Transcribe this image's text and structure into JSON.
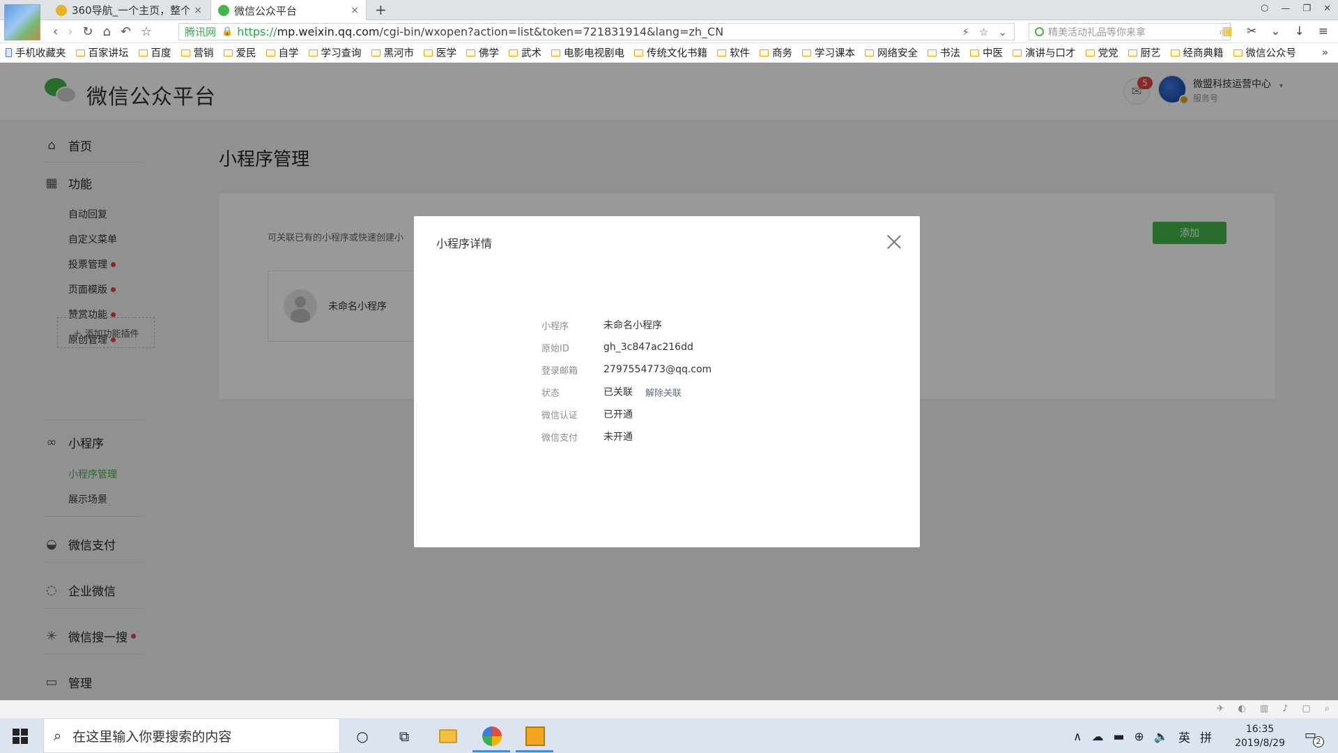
{
  "browser": {
    "tabs": [
      {
        "title": "360导航_一个主页，整个",
        "close": "×"
      },
      {
        "title": "微信公众平台",
        "close": "×"
      }
    ],
    "new_tab": "+",
    "window_controls": [
      "⬡",
      "—",
      "❐",
      "✕"
    ],
    "nav": {
      "back": "‹",
      "forward": "›",
      "reload": "↻",
      "home": "⌂",
      "undo": "↶",
      "favorite": "☆"
    },
    "address": {
      "shield_label": "腾讯网",
      "scheme": "https://",
      "host": "mp.weixin.qq.com",
      "path": "/cgi-bin/wxopen?action=list&token=721831914&lang=zh_CN",
      "icons": [
        "⚡",
        "☆",
        "⌄"
      ]
    },
    "search": {
      "placeholder": "精美活动礼品等你来拿",
      "icon": "⌕"
    },
    "tool_icons": [
      "▦",
      "✂",
      "⌄",
      "↓",
      "≡"
    ],
    "bookmarks": [
      "手机收藏夹",
      "百家讲坛",
      "百度",
      "营销",
      "爱民",
      "自学",
      "学习查询",
      "黑河市",
      "医学",
      "佛学",
      "武术",
      "电影电视剧电",
      "传统文化书籍",
      "软件",
      "商务",
      "学习课本",
      "网络安全",
      "书法",
      "中医",
      "演讲与口才",
      "党党",
      "厨艺",
      "经商典籍",
      "微信公众号"
    ],
    "bookmarks_more": "»"
  },
  "header": {
    "site_title": "微信公众平台",
    "message_icon": "✉",
    "message_count": "5",
    "account_name": "微盟科技运营中心",
    "account_type": "服务号",
    "caret": "▾"
  },
  "sidebar": {
    "home": {
      "icon": "⌂",
      "label": "首页"
    },
    "features": {
      "icon": "▦",
      "label": "功能",
      "items": [
        {
          "label": "自动回复",
          "dot": false
        },
        {
          "label": "自定义菜单",
          "dot": false
        },
        {
          "label": "投票管理",
          "dot": true
        },
        {
          "label": "页面模版",
          "dot": true
        },
        {
          "label": "赞赏功能",
          "dot": true
        },
        {
          "label": "原创管理",
          "dot": true
        }
      ],
      "add_plugin": "＋ 添加功能插件"
    },
    "miniprogram": {
      "icon": "∞",
      "label": "小程序",
      "items": [
        {
          "label": "小程序管理",
          "active": true
        },
        {
          "label": "展示场景",
          "active": false
        }
      ]
    },
    "wechat_pay": {
      "icon": "◒",
      "label": "微信支付"
    },
    "work_wechat": {
      "icon": "◌",
      "label": "企业微信"
    },
    "wechat_search": {
      "icon": "✳",
      "label": "微信搜一搜"
    },
    "manage": {
      "icon": "▭",
      "label": "管理"
    }
  },
  "content": {
    "title": "小程序管理",
    "description": "可关联已有的小程序或快速创建小",
    "add_button": "添加",
    "card": {
      "name": "未命名小程序"
    }
  },
  "dialog": {
    "title": "小程序详情",
    "rows": [
      {
        "label": "小程序",
        "value": "未命名小程序"
      },
      {
        "label": "原始ID",
        "value": "gh_3c847ac216dd"
      },
      {
        "label": "登录邮箱",
        "value": "2797554773@qq.com"
      },
      {
        "label": "状态",
        "value": "已关联",
        "link": "解除关联"
      },
      {
        "label": "微信认证",
        "value": "已开通"
      },
      {
        "label": "微信支付",
        "value": "未开通"
      }
    ]
  },
  "statusbar_icons": [
    "✈",
    "◐",
    "▥",
    "♪",
    "▢",
    "⌕"
  ],
  "taskbar": {
    "search_placeholder": "在这里输入你要搜索的内容",
    "search_icon": "⌕",
    "cortana": "○",
    "taskview": "⧉",
    "tray": [
      "∧",
      "☁",
      "▬",
      "⊕",
      "🔈",
      "英",
      "拼"
    ],
    "time": "16:35",
    "date": "2019/8/29",
    "notify_icon": "▭",
    "notify_count": "2"
  },
  "colors": {
    "accent": "#44b549",
    "link": "#576b95",
    "badge": "#e64340"
  }
}
